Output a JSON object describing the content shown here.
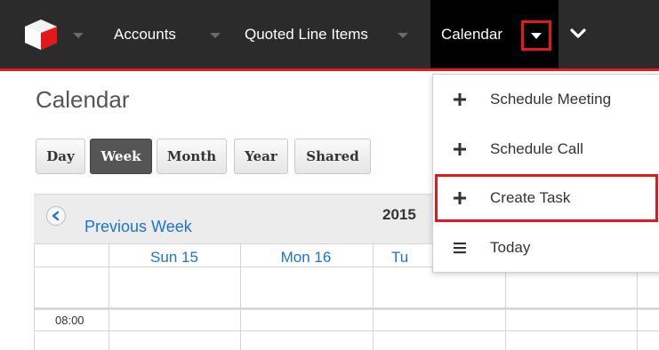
{
  "nav": {
    "logo_icon": "sugar-cube-logo-icon",
    "items": [
      {
        "label": "Accounts"
      },
      {
        "label": "Quoted Line Items"
      },
      {
        "label": "Calendar"
      }
    ],
    "more_icon": "chevron-down-icon",
    "accent_color": "#e61718"
  },
  "page": {
    "title": "Calendar"
  },
  "views": [
    "Day",
    "Week",
    "Month",
    "Year",
    "Shared"
  ],
  "active_view": "Week",
  "calendar": {
    "prev_label": "Previous Week",
    "year": "2015",
    "days": [
      "Sun 15",
      "Mon 16",
      "Tu"
    ],
    "time": "08:00"
  },
  "menu": {
    "items": [
      {
        "label": "Schedule Meeting",
        "icon": "plus-icon"
      },
      {
        "label": "Schedule Call",
        "icon": "plus-icon"
      },
      {
        "label": "Create Task",
        "icon": "plus-icon"
      },
      {
        "label": "Today",
        "icon": "list-icon"
      }
    ]
  }
}
